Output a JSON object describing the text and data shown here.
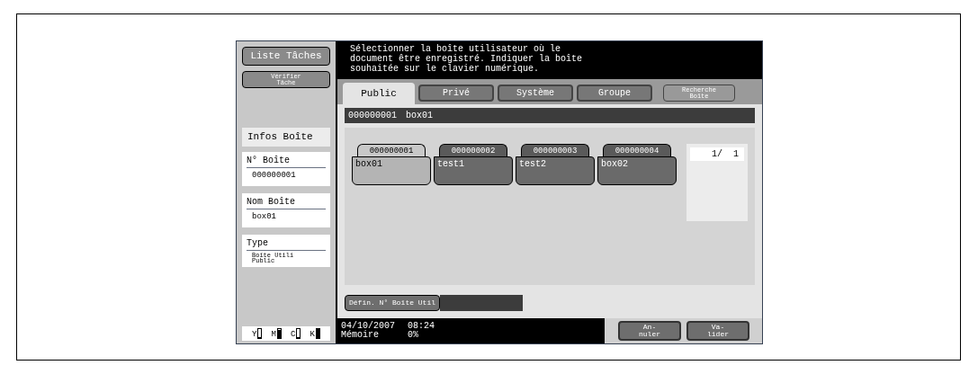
{
  "sidebar": {
    "buttons": [
      {
        "label": "Liste Tâches",
        "kind": "large"
      },
      {
        "label": "Vérifier\nTâche",
        "kind": "small"
      }
    ],
    "info_title": "Infos Boîte",
    "fields": [
      {
        "label": "N° Boîte",
        "value": "000000001",
        "kind": "large"
      },
      {
        "label": "Nom Boîte",
        "value": "box01",
        "kind": "large"
      },
      {
        "label": "Type",
        "value": "Boîte Utili\nPublic",
        "kind": "small"
      }
    ],
    "toner": [
      {
        "label": "Y",
        "level": 0.15
      },
      {
        "label": "M",
        "level": 0.9
      },
      {
        "label": "C",
        "level": 0.15
      },
      {
        "label": "K",
        "level": 1
      }
    ]
  },
  "message": "Sélectionner la boîte utilisateur où le\ndocument être enregistré. Indiquer la boîte\nsouhaitée sur le clavier numérique.",
  "tabs": [
    {
      "label": "Public",
      "selected": true
    },
    {
      "label": "Privé",
      "selected": false
    },
    {
      "label": "Système",
      "selected": false
    },
    {
      "label": "Groupe",
      "selected": false
    }
  ],
  "search_button": "Recherche\nBoîte",
  "current_box": {
    "number": "000000001",
    "name": "box01"
  },
  "boxes": [
    {
      "number": "000000001",
      "name": "box01",
      "selected": true
    },
    {
      "number": "000000002",
      "name": "test1",
      "selected": false
    },
    {
      "number": "000000003",
      "name": "test2",
      "selected": false
    },
    {
      "number": "000000004",
      "name": "box02",
      "selected": false
    }
  ],
  "pager": "1/  1",
  "set_number_button": "Défin. N° Boîte Util",
  "status_bar": {
    "date": "04/10/2007",
    "time": "08:24",
    "memory_label": "Mémoire",
    "memory_value": "0%"
  },
  "buttons": [
    "An-\nnuler",
    "Va-\nlider"
  ]
}
